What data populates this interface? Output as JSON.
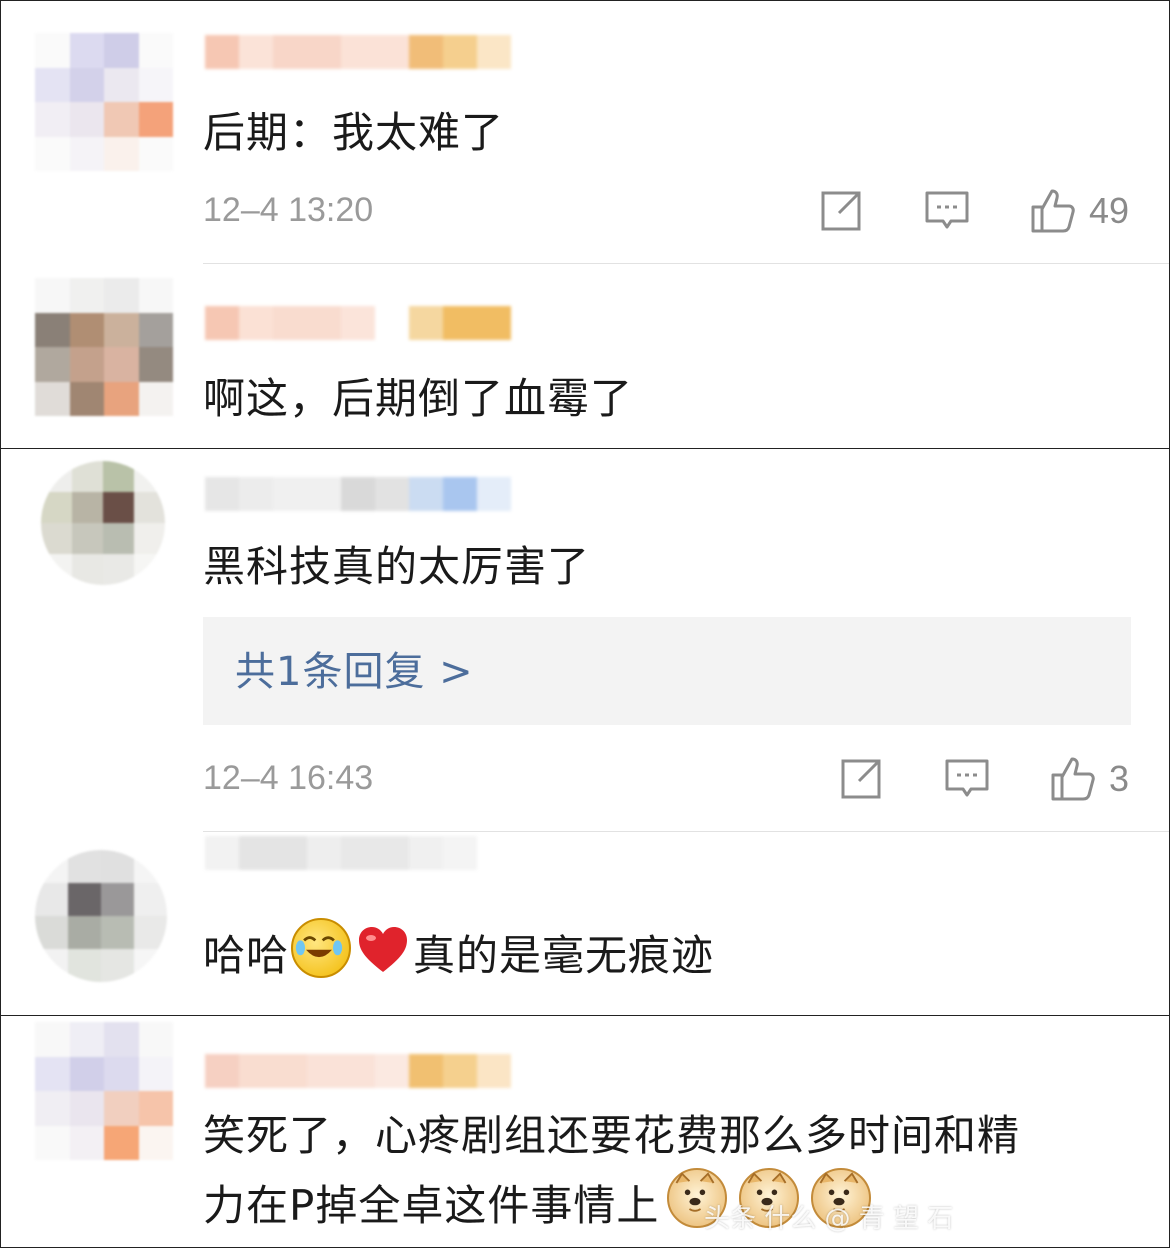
{
  "colors": {
    "text": "#1a1a1a",
    "timestamp": "#9a9a9a",
    "reply_link": "#4c6d9b",
    "reply_bg": "#f3f3f3"
  },
  "comments": [
    {
      "text": "后期：我太难了",
      "time": "12–4 13:20",
      "likes": "49",
      "icons": [
        "share-icon",
        "reply-icon",
        "like-icon"
      ]
    },
    {
      "text": "啊这，后期倒了血霉了"
    },
    {
      "text": "黑科技真的太厉害了",
      "reply_link": "共1条回复 >",
      "time": "12–4 16:43",
      "likes": "3",
      "icons": [
        "share-icon",
        "reply-icon",
        "like-icon"
      ]
    },
    {
      "text_before": "哈哈",
      "text_after": "真的是毫无痕迹",
      "emojis": [
        "laugh-cry-emoji",
        "heart-emoji"
      ]
    },
    {
      "line1": "笑死了，心疼剧组还要花费那么多时间和精",
      "line2": "力在P掉全卓这件事情上",
      "emojis": [
        "doge-emoji",
        "doge-emoji",
        "doge-emoji"
      ]
    }
  ],
  "watermark": "头条 什么 @ 青 望 石"
}
